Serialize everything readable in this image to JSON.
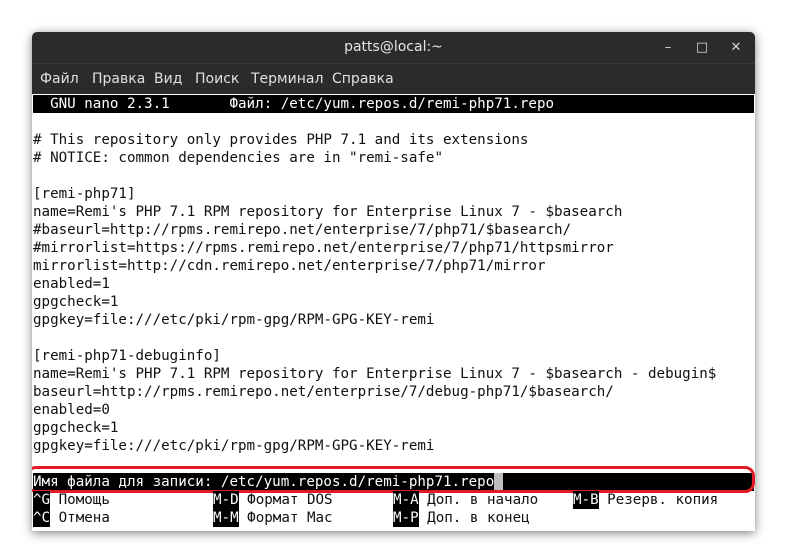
{
  "window": {
    "title": "patts@local:~"
  },
  "controls": {
    "minimize": "–",
    "maximize": "□",
    "close": "✕"
  },
  "menu": [
    "Файл",
    "Правка",
    "Вид",
    "Поиск",
    "Терминал",
    "Справка"
  ],
  "nano": {
    "status": "  GNU nano 2.3.1       Файл: /etc/yum.repos.d/remi-php71.repo",
    "lines": [
      "",
      "# This repository only provides PHP 7.1 and its extensions",
      "# NOTICE: common dependencies are in \"remi-safe\"",
      "",
      "[remi-php71]",
      "name=Remi's PHP 7.1 RPM repository for Enterprise Linux 7 - $basearch",
      "#baseurl=http://rpms.remirepo.net/enterprise/7/php71/$basearch/",
      "#mirrorlist=https://rpms.remirepo.net/enterprise/7/php71/httpsmirror",
      "mirrorlist=http://cdn.remirepo.net/enterprise/7/php71/mirror",
      "enabled=1",
      "gpgcheck=1",
      "gpgkey=file:///etc/pki/rpm-gpg/RPM-GPG-KEY-remi",
      "",
      "[remi-php71-debuginfo]",
      "name=Remi's PHP 7.1 RPM repository for Enterprise Linux 7 - $basearch - debugin$",
      "baseurl=http://rpms.remirepo.net/enterprise/7/debug-php71/$basearch/",
      "enabled=0",
      "gpgcheck=1",
      "gpgkey=file:///etc/pki/rpm-gpg/RPM-GPG-KEY-remi"
    ],
    "prompt": "Имя файла для записи: /etc/yum.repos.d/remi-php71.repo",
    "shortcuts_row1": [
      {
        "key": "^G",
        "label": "Помощь"
      },
      {
        "key": "M-D",
        "label": "Формат DOS"
      },
      {
        "key": "M-A",
        "label": "Доп. в начало"
      },
      {
        "key": "M-B",
        "label": "Резерв. копия"
      }
    ],
    "shortcuts_row2": [
      {
        "key": "^C",
        "label": "Отмена"
      },
      {
        "key": "M-M",
        "label": "Формат Mac"
      },
      {
        "key": "M-P",
        "label": "Доп. в конец"
      }
    ]
  },
  "colors": {
    "highlight": "#e01b24",
    "titlebar": "#2b2b2b"
  }
}
